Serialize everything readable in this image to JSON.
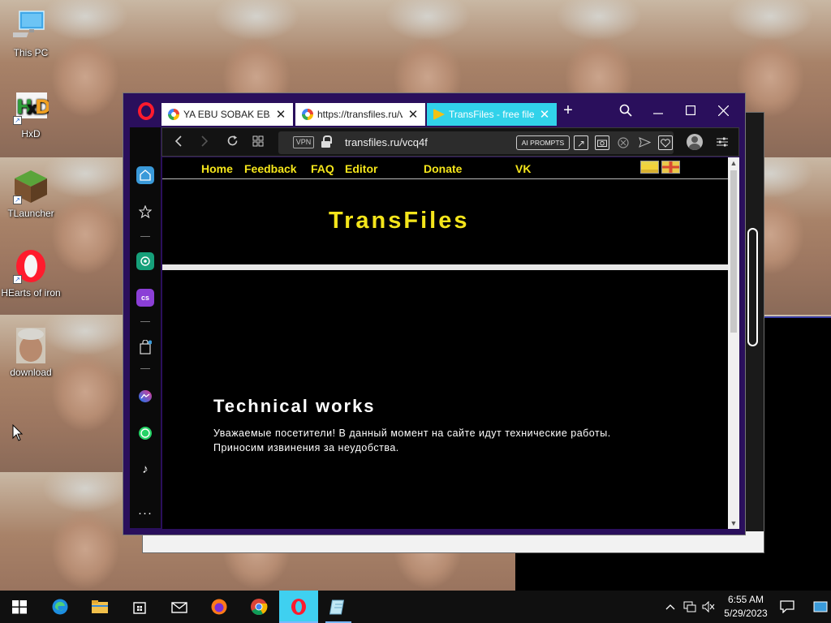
{
  "desktop": {
    "icons": [
      {
        "label": "This PC"
      },
      {
        "label": "HxD"
      },
      {
        "label": "TLauncher"
      },
      {
        "label": "HEarts of iron"
      },
      {
        "label": "download"
      }
    ]
  },
  "browser": {
    "tabs": [
      {
        "label": "YA EBU SOBAK EBAN"
      },
      {
        "label": "https://transfiles.ru/v"
      },
      {
        "label": "TransFiles - free file"
      }
    ],
    "new_tab": "+",
    "address": {
      "vpn_label": "VPN",
      "url": "transfiles.ru/vcq4f",
      "ai_prompts_label": "AI PROMPTS"
    }
  },
  "page": {
    "nav": {
      "home": "Home",
      "feedback": "Feedback",
      "faq": "FAQ",
      "editor": "Editor",
      "donate": "Donate",
      "vk": "VK"
    },
    "site_title": "TransFiles",
    "notice": {
      "heading": "Technical works",
      "line1": "Уважаемые посетители! В данный момент на сайте идут технические работы.",
      "line2": "Приносим извинения за неудобства."
    }
  },
  "taskbar": {
    "clock_time": "6:55 AM",
    "clock_date": "5/29/2023"
  },
  "colors": {
    "site_accent": "#f4e51b",
    "active_tab": "#31d2ea",
    "opera_red": "#ff1b2d",
    "browser_frame": "#2a0f5c"
  }
}
